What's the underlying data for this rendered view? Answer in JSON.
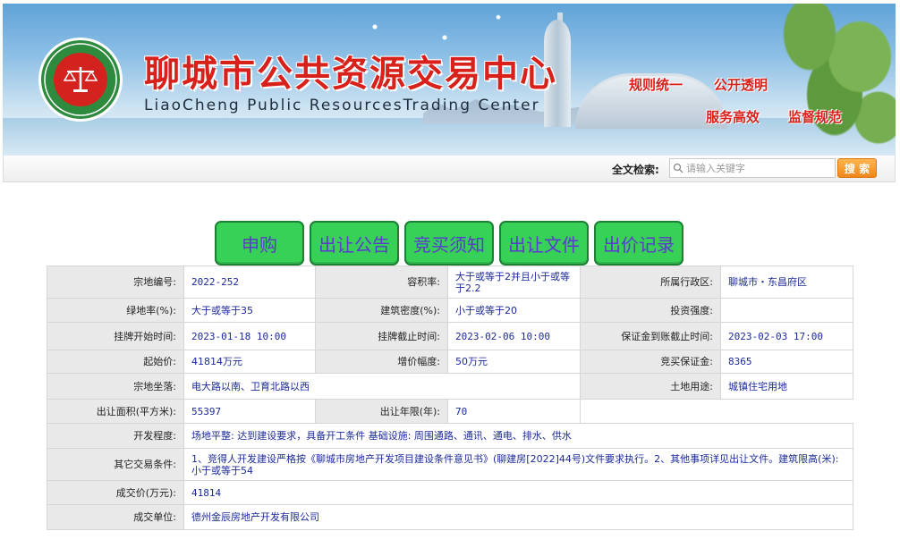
{
  "header": {
    "title": "聊城市公共资源交易中心",
    "subtitle": "LiaoCheng Public ResourcesTrading Center",
    "slogans": [
      "规则统一",
      "公开透明",
      "服务高效",
      "监督规范"
    ],
    "logo_icon": "scales-of-justice-icon"
  },
  "search": {
    "label": "全文检索:",
    "placeholder": "请输入关键字",
    "button_label": "搜 索"
  },
  "actions": [
    {
      "label": "申购"
    },
    {
      "label": "出让公告"
    },
    {
      "label": "竞买须知"
    },
    {
      "label": "出让文件"
    },
    {
      "label": "出价记录"
    }
  ],
  "parcel": {
    "code_label": "宗地编号:",
    "code": "2022-252",
    "plot_ratio_label": "容积率:",
    "plot_ratio": "大于或等于2并且小于或等于2.2",
    "district_label": "所属行政区:",
    "district": "聊城市・东昌府区",
    "green_rate_label": "绿地率(%):",
    "green_rate": "大于或等于35",
    "building_density_label": "建筑密度(%):",
    "building_density": "小于或等于20",
    "investment_intensity_label": "投资强度:",
    "investment_intensity": "",
    "listing_start_label": "挂牌开始时间:",
    "listing_start": "2023-01-18 10:00",
    "listing_end_label": "挂牌截止时间:",
    "listing_end": "2023-02-06 10:00",
    "deposit_deadline_label": "保证金到账截止时间:",
    "deposit_deadline": "2023-02-03 17:00",
    "starting_price_label": "起始价:",
    "starting_price": "41814万元",
    "increment_label": "增价幅度:",
    "increment": "50万元",
    "deposit_label": "竞买保证金:",
    "deposit": "8365",
    "location_label": "宗地坐落:",
    "location": "电大路以南、卫育北路以西",
    "land_use_label": "土地用途:",
    "land_use": "城镇住宅用地",
    "area_label": "出让面积(平方米):",
    "area": "55397",
    "term_label": "出让年限(年):",
    "term": "70",
    "development_label": "开发程度:",
    "development": "场地平整: 达到建设要求，具备开工条件 基础设施: 周围通路、通讯、通电、排水、供水",
    "other_conditions_label": "其它交易条件:",
    "other_conditions": "1、竞得人开发建设严格按《聊城市房地产开发项目建设条件意见书》(聊建房[2022]44号)文件要求执行。2、其他事项详见出让文件。建筑限高(米): 小于或等于54",
    "deal_price_label": "成交价(万元):",
    "deal_price": "41814",
    "winner_label": "成交单位:",
    "winner": "德州金辰房地产开发有限公司"
  }
}
